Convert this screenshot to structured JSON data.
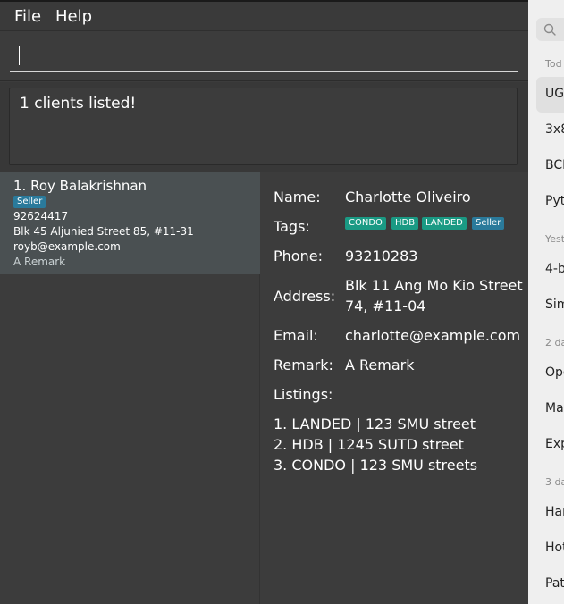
{
  "menu": {
    "file": "File",
    "help": "Help"
  },
  "command": {
    "value": ""
  },
  "result": {
    "text": "1 clients listed!"
  },
  "clients": [
    {
      "name": "1. Roy Balakrishnan",
      "tags": [
        {
          "label": "Seller",
          "color": "#2a7a9b"
        }
      ],
      "phone": "92624417",
      "address": "Blk 45 Aljunied Street 85, #11-31",
      "email": "royb@example.com",
      "remark": "A Remark"
    }
  ],
  "detail": {
    "labels": {
      "name": "Name:",
      "tags": "Tags:",
      "phone": "Phone:",
      "address": "Address:",
      "email": "Email:",
      "remark": "Remark:",
      "listings": "Listings:"
    },
    "name": "Charlotte Oliveiro",
    "tags": [
      {
        "label": "CONDO",
        "color": "#1a9a84"
      },
      {
        "label": "HDB",
        "color": "#1a9a84"
      },
      {
        "label": "LANDED",
        "color": "#1a9a84"
      },
      {
        "label": "Seller",
        "color": "#2a7a9b"
      }
    ],
    "phone": "93210283",
    "address_line1": "Blk 11 Ang Mo Kio Street",
    "address_line2": "74, #11-04",
    "email": "charlotte@example.com",
    "remark": "A Remark",
    "listings": [
      "1. LANDED | 123 SMU street",
      "2. HDB | 1245 SUTD street",
      "3. CONDO | 123 SMU streets"
    ]
  },
  "sidebar": {
    "search_icon": "search-icon",
    "groups": [
      {
        "header": "Tod",
        "items": [
          "UG",
          "3x8",
          "BCI",
          "Pyt"
        ]
      },
      {
        "header": "Yest",
        "items": [
          "4-b",
          "Sim"
        ]
      },
      {
        "header": "2 da",
        "items": [
          "Ope",
          "Mat",
          "Exp"
        ]
      },
      {
        "header": "3 da",
        "items": [
          "Har",
          "Hot",
          "Pat"
        ]
      }
    ]
  }
}
